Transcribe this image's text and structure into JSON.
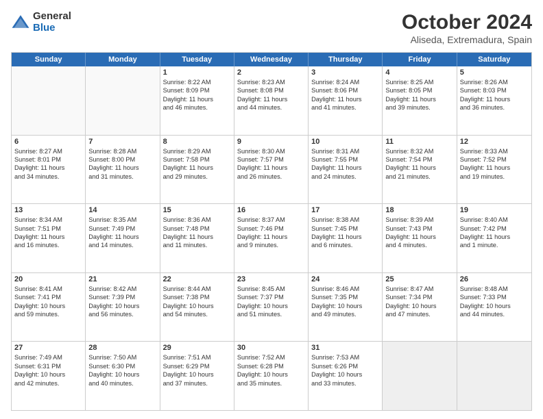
{
  "logo": {
    "general": "General",
    "blue": "Blue"
  },
  "title": "October 2024",
  "subtitle": "Aliseda, Extremadura, Spain",
  "days_of_week": [
    "Sunday",
    "Monday",
    "Tuesday",
    "Wednesday",
    "Thursday",
    "Friday",
    "Saturday"
  ],
  "weeks": [
    [
      {
        "day": "",
        "empty": true
      },
      {
        "day": "",
        "empty": true
      },
      {
        "day": "1",
        "lines": [
          "Sunrise: 8:22 AM",
          "Sunset: 8:09 PM",
          "Daylight: 11 hours",
          "and 46 minutes."
        ]
      },
      {
        "day": "2",
        "lines": [
          "Sunrise: 8:23 AM",
          "Sunset: 8:08 PM",
          "Daylight: 11 hours",
          "and 44 minutes."
        ]
      },
      {
        "day": "3",
        "lines": [
          "Sunrise: 8:24 AM",
          "Sunset: 8:06 PM",
          "Daylight: 11 hours",
          "and 41 minutes."
        ]
      },
      {
        "day": "4",
        "lines": [
          "Sunrise: 8:25 AM",
          "Sunset: 8:05 PM",
          "Daylight: 11 hours",
          "and 39 minutes."
        ]
      },
      {
        "day": "5",
        "lines": [
          "Sunrise: 8:26 AM",
          "Sunset: 8:03 PM",
          "Daylight: 11 hours",
          "and 36 minutes."
        ]
      }
    ],
    [
      {
        "day": "6",
        "lines": [
          "Sunrise: 8:27 AM",
          "Sunset: 8:01 PM",
          "Daylight: 11 hours",
          "and 34 minutes."
        ]
      },
      {
        "day": "7",
        "lines": [
          "Sunrise: 8:28 AM",
          "Sunset: 8:00 PM",
          "Daylight: 11 hours",
          "and 31 minutes."
        ]
      },
      {
        "day": "8",
        "lines": [
          "Sunrise: 8:29 AM",
          "Sunset: 7:58 PM",
          "Daylight: 11 hours",
          "and 29 minutes."
        ]
      },
      {
        "day": "9",
        "lines": [
          "Sunrise: 8:30 AM",
          "Sunset: 7:57 PM",
          "Daylight: 11 hours",
          "and 26 minutes."
        ]
      },
      {
        "day": "10",
        "lines": [
          "Sunrise: 8:31 AM",
          "Sunset: 7:55 PM",
          "Daylight: 11 hours",
          "and 24 minutes."
        ]
      },
      {
        "day": "11",
        "lines": [
          "Sunrise: 8:32 AM",
          "Sunset: 7:54 PM",
          "Daylight: 11 hours",
          "and 21 minutes."
        ]
      },
      {
        "day": "12",
        "lines": [
          "Sunrise: 8:33 AM",
          "Sunset: 7:52 PM",
          "Daylight: 11 hours",
          "and 19 minutes."
        ]
      }
    ],
    [
      {
        "day": "13",
        "lines": [
          "Sunrise: 8:34 AM",
          "Sunset: 7:51 PM",
          "Daylight: 11 hours",
          "and 16 minutes."
        ]
      },
      {
        "day": "14",
        "lines": [
          "Sunrise: 8:35 AM",
          "Sunset: 7:49 PM",
          "Daylight: 11 hours",
          "and 14 minutes."
        ]
      },
      {
        "day": "15",
        "lines": [
          "Sunrise: 8:36 AM",
          "Sunset: 7:48 PM",
          "Daylight: 11 hours",
          "and 11 minutes."
        ]
      },
      {
        "day": "16",
        "lines": [
          "Sunrise: 8:37 AM",
          "Sunset: 7:46 PM",
          "Daylight: 11 hours",
          "and 9 minutes."
        ]
      },
      {
        "day": "17",
        "lines": [
          "Sunrise: 8:38 AM",
          "Sunset: 7:45 PM",
          "Daylight: 11 hours",
          "and 6 minutes."
        ]
      },
      {
        "day": "18",
        "lines": [
          "Sunrise: 8:39 AM",
          "Sunset: 7:43 PM",
          "Daylight: 11 hours",
          "and 4 minutes."
        ]
      },
      {
        "day": "19",
        "lines": [
          "Sunrise: 8:40 AM",
          "Sunset: 7:42 PM",
          "Daylight: 11 hours",
          "and 1 minute."
        ]
      }
    ],
    [
      {
        "day": "20",
        "lines": [
          "Sunrise: 8:41 AM",
          "Sunset: 7:41 PM",
          "Daylight: 10 hours",
          "and 59 minutes."
        ]
      },
      {
        "day": "21",
        "lines": [
          "Sunrise: 8:42 AM",
          "Sunset: 7:39 PM",
          "Daylight: 10 hours",
          "and 56 minutes."
        ]
      },
      {
        "day": "22",
        "lines": [
          "Sunrise: 8:44 AM",
          "Sunset: 7:38 PM",
          "Daylight: 10 hours",
          "and 54 minutes."
        ]
      },
      {
        "day": "23",
        "lines": [
          "Sunrise: 8:45 AM",
          "Sunset: 7:37 PM",
          "Daylight: 10 hours",
          "and 51 minutes."
        ]
      },
      {
        "day": "24",
        "lines": [
          "Sunrise: 8:46 AM",
          "Sunset: 7:35 PM",
          "Daylight: 10 hours",
          "and 49 minutes."
        ]
      },
      {
        "day": "25",
        "lines": [
          "Sunrise: 8:47 AM",
          "Sunset: 7:34 PM",
          "Daylight: 10 hours",
          "and 47 minutes."
        ]
      },
      {
        "day": "26",
        "lines": [
          "Sunrise: 8:48 AM",
          "Sunset: 7:33 PM",
          "Daylight: 10 hours",
          "and 44 minutes."
        ]
      }
    ],
    [
      {
        "day": "27",
        "lines": [
          "Sunrise: 7:49 AM",
          "Sunset: 6:31 PM",
          "Daylight: 10 hours",
          "and 42 minutes."
        ]
      },
      {
        "day": "28",
        "lines": [
          "Sunrise: 7:50 AM",
          "Sunset: 6:30 PM",
          "Daylight: 10 hours",
          "and 40 minutes."
        ]
      },
      {
        "day": "29",
        "lines": [
          "Sunrise: 7:51 AM",
          "Sunset: 6:29 PM",
          "Daylight: 10 hours",
          "and 37 minutes."
        ]
      },
      {
        "day": "30",
        "lines": [
          "Sunrise: 7:52 AM",
          "Sunset: 6:28 PM",
          "Daylight: 10 hours",
          "and 35 minutes."
        ]
      },
      {
        "day": "31",
        "lines": [
          "Sunrise: 7:53 AM",
          "Sunset: 6:26 PM",
          "Daylight: 10 hours",
          "and 33 minutes."
        ]
      },
      {
        "day": "",
        "empty": true,
        "shaded": true
      },
      {
        "day": "",
        "empty": true,
        "shaded": true
      }
    ]
  ]
}
